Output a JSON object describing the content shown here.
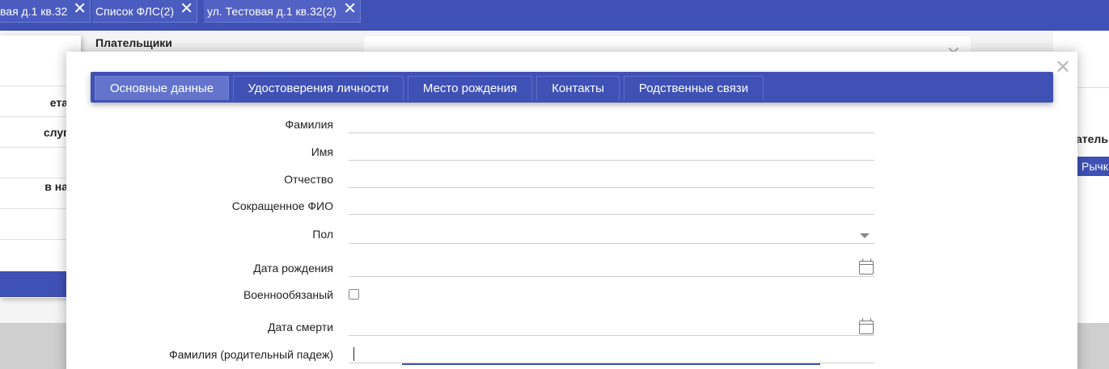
{
  "top_tabs": [
    {
      "label": "вая д.1 кв.32"
    },
    {
      "label": "Список ФЛС(2)"
    },
    {
      "label": "ул. Тестовая д.1 кв.32(2)"
    }
  ],
  "close_glyph": "✕",
  "background": {
    "left_rows": [
      "ета",
      "слуг",
      "в на"
    ],
    "center_title": "Плательщики",
    "right_header": "атель",
    "right_chip": "Рычка"
  },
  "modal": {
    "tabs": [
      {
        "label": "Основные данные",
        "active": true
      },
      {
        "label": "Удостоверения личности",
        "active": false
      },
      {
        "label": "Место рождения",
        "active": false
      },
      {
        "label": "Контакты",
        "active": false
      },
      {
        "label": "Родственные связи",
        "active": false
      }
    ],
    "fields": [
      {
        "label": "Фамилия",
        "value": "",
        "type": "text"
      },
      {
        "label": "Имя",
        "value": "",
        "type": "text"
      },
      {
        "label": "Отчество",
        "value": "",
        "type": "text"
      },
      {
        "label": "Сокращенное ФИО",
        "value": "",
        "type": "text"
      },
      {
        "label": "Пол",
        "value": "",
        "type": "select"
      },
      {
        "label": "Дата рождения",
        "value": "",
        "type": "date"
      },
      {
        "label": "Военнообязаный",
        "value": false,
        "type": "checkbox"
      },
      {
        "label": "Дата смерти",
        "value": "",
        "type": "date"
      },
      {
        "label": "Фамилия (родительный падеж)",
        "value": "",
        "type": "text"
      }
    ]
  },
  "colors": {
    "accent": "#3f51b5",
    "active_tab": "#6474cc"
  }
}
